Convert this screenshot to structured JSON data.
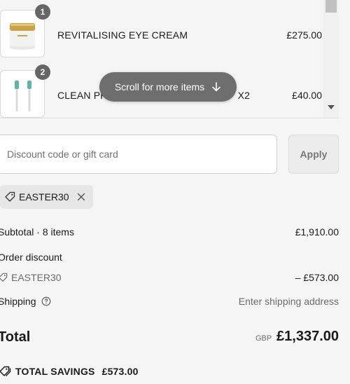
{
  "line_items": [
    {
      "quantity": "1",
      "name": "REVITALISING EYE CREAM",
      "price": "£275.00",
      "image": "eye-cream-jar"
    },
    {
      "quantity": "2",
      "name": "CLEAN PR",
      "name_suffix": "X2",
      "price": "£40.00",
      "image": "toothbrush-heads"
    }
  ],
  "scroll_hint": {
    "label": "Scroll for more items",
    "icon": "arrow-down-icon"
  },
  "discount": {
    "placeholder": "Discount code or gift card",
    "value": "",
    "apply_label": "Apply"
  },
  "applied_code": {
    "code": "EASTER30",
    "icon": "tag-icon",
    "remove_icon": "close-icon"
  },
  "summary": {
    "subtotal_label": "Subtotal · 8 items",
    "subtotal_value": "£1,910.00",
    "order_discount_label": "Order discount",
    "discount_code": "EASTER30",
    "discount_value": "– £573.00",
    "shipping_label": "Shipping",
    "shipping_value": "Enter shipping address",
    "total_label": "Total",
    "currency": "GBP",
    "total_value": "£1,337.00",
    "savings_label": "TOTAL SAVINGS",
    "savings_value": "£573.00"
  },
  "colors": {
    "badge": "#666666",
    "pill": "#6e6e6e",
    "background": "#f5f5f5"
  }
}
